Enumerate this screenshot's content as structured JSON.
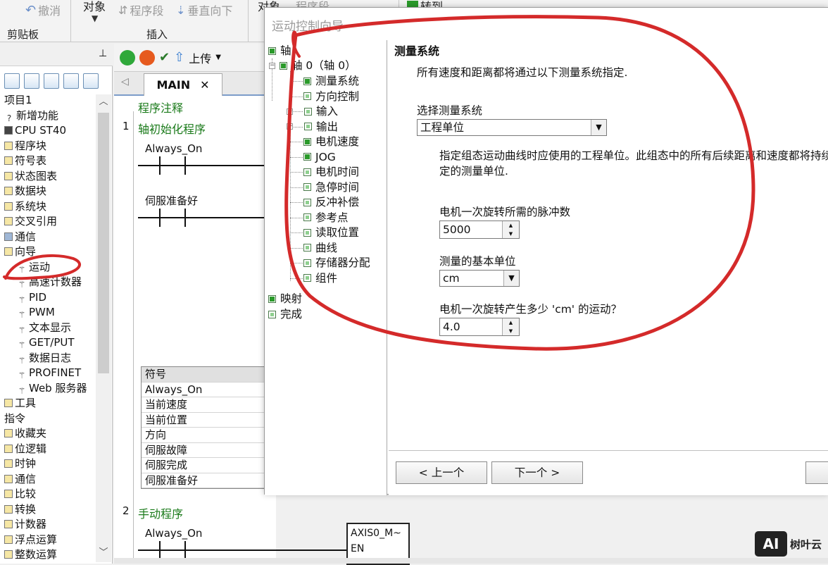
{
  "ribbon": {
    "undo_label": "撤消",
    "object_label": "对象",
    "segment_label": "程序段",
    "vertical_down_label": "垂直向下",
    "object_label2": "对象",
    "segment_label2": "程序段",
    "goto_label": "转到",
    "clipboard_group": "剪贴板",
    "insert_group": "插入"
  },
  "left_tree": {
    "pin_glyph": "ᵖ",
    "items": [
      {
        "label": "项目1",
        "icon": "project"
      },
      {
        "label": "新增功能",
        "icon": "help-icon"
      },
      {
        "label": "CPU ST40",
        "icon": "cpu-icon"
      },
      {
        "label": "程序块",
        "icon": "folder-icon"
      },
      {
        "label": "符号表",
        "icon": "folder-icon"
      },
      {
        "label": "状态图表",
        "icon": "folder-icon"
      },
      {
        "label": "数据块",
        "icon": "folder-icon"
      },
      {
        "label": "系统块",
        "icon": "system-icon"
      },
      {
        "label": "交叉引用",
        "icon": "folder-icon"
      },
      {
        "label": "通信",
        "icon": "network-icon"
      },
      {
        "label": "向导",
        "icon": "folder-icon"
      },
      {
        "label": "运动",
        "icon": "wand-icon"
      },
      {
        "label": "高速计数器",
        "icon": "wand-icon"
      },
      {
        "label": "PID",
        "icon": "wand-icon"
      },
      {
        "label": "PWM",
        "icon": "wand-icon"
      },
      {
        "label": "文本显示",
        "icon": "wand-icon"
      },
      {
        "label": "GET/PUT",
        "icon": "wand-icon"
      },
      {
        "label": "数据日志",
        "icon": "wand-icon"
      },
      {
        "label": "PROFINET",
        "icon": "wand-icon"
      },
      {
        "label": "Web 服务器",
        "icon": "wand-icon"
      },
      {
        "label": "工具",
        "icon": "folder-icon"
      },
      {
        "label": "指令",
        "icon": "none"
      },
      {
        "label": "收藏夹",
        "icon": "folder-icon"
      },
      {
        "label": "位逻辑",
        "icon": "folder-icon"
      },
      {
        "label": "时钟",
        "icon": "clock-icon"
      },
      {
        "label": "通信",
        "icon": "folder-icon"
      },
      {
        "label": "比较",
        "icon": "folder-icon"
      },
      {
        "label": "转换",
        "icon": "folder-icon"
      },
      {
        "label": "计数器",
        "icon": "folder-icon"
      },
      {
        "label": "浮点运算",
        "icon": "folder-icon"
      },
      {
        "label": "整数运算",
        "icon": "folder-icon"
      }
    ]
  },
  "editor": {
    "upload_label": "上传",
    "tab_label": "MAIN",
    "program_comment": "程序注释",
    "network1_num": "1",
    "network1_title": "轴初始化程序",
    "contact1": "Always_On",
    "contact2": "伺服准备好",
    "symbol_header": "符号",
    "symbols": [
      "Always_On",
      "当前速度",
      "当前位置",
      "方向",
      "伺服故障",
      "伺服完成",
      "伺服准备好"
    ],
    "network2_num": "2",
    "network2_title": "手动程序",
    "contact3": "Always_On",
    "fb_name": "AXIS0_M~",
    "fb_en": "EN"
  },
  "dialog": {
    "title": "运动控制向导",
    "nav": {
      "axis": "轴",
      "axis0": "轴 0（轴 0）",
      "children": [
        "测量系统",
        "方向控制",
        "输入",
        "输出",
        "电机速度",
        "JOG",
        "电机时间",
        "急停时间",
        "反冲补偿",
        "参考点",
        "读取位置",
        "曲线",
        "存储器分配",
        "组件"
      ],
      "mapping": "映射",
      "finish": "完成"
    },
    "content": {
      "heading": "测量系统",
      "intro": "所有速度和距离都将通过以下测量系统指定.",
      "select_system_label": "选择测量系统",
      "select_system_value": "工程单位",
      "desc_line1": "指定组态运动曲线时应使用的工程单位。此组态中的所有后续距离和速度都将持续",
      "desc_line2": "定的测量单位.",
      "pulses_label": "电机一次旋转所需的脉冲数",
      "pulses_value": "5000",
      "unit_label": "测量的基本单位",
      "unit_value": "cm",
      "motion_label": "电机一次旋转产生多少 'cm' 的运动？",
      "motion_value": "4.0"
    },
    "buttons": {
      "prev": "< 上一个",
      "next": "下一个 >"
    }
  },
  "watermark": {
    "logo": "AI",
    "text": "树叶云"
  },
  "colors": {
    "annotation_red": "#d42a2a",
    "accent_green": "#1a7a1a"
  }
}
